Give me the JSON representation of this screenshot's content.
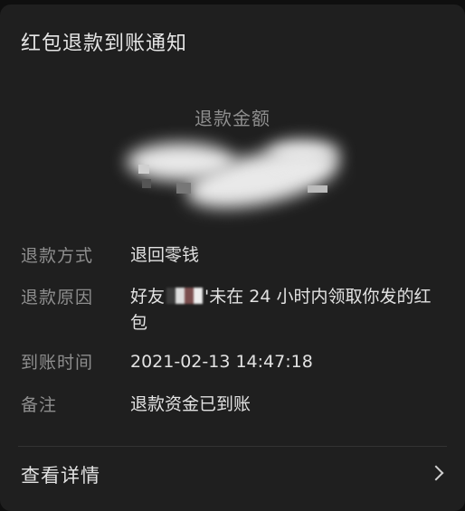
{
  "notification": {
    "title": "红包退款到账通知",
    "amount_label": "退款金额"
  },
  "fields": [
    {
      "key": "退款方式",
      "value": "退回零钱"
    },
    {
      "key": "退款原因",
      "value_prefix": "好友",
      "value_suffix": "'未在 24 小时内领取你发的红包"
    },
    {
      "key": "到账时间",
      "value": "2021-02-13 14:47:18"
    },
    {
      "key": "备注",
      "value": "退款资金已到账"
    }
  ],
  "footer": {
    "details_label": "查看详情",
    "chevron_icon": "chevron-right-icon"
  },
  "colors": {
    "card_background": "#1f1f1f",
    "label_gray": "#8e8e8e",
    "value_light": "#e2e2e2"
  }
}
